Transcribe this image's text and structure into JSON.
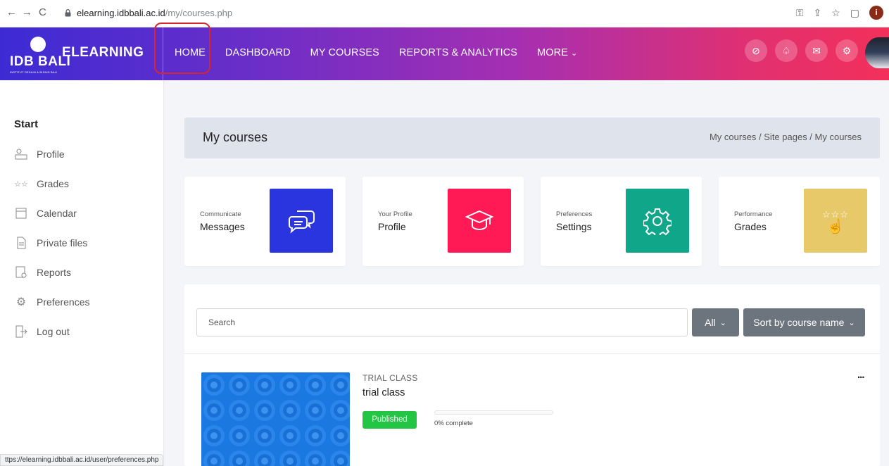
{
  "browser": {
    "url_host": "elearning.idbbali.ac.id",
    "url_path": "/my/courses.php",
    "status_url": "ttps://elearning.idbbali.ac.id/user/preferences.php",
    "profile_initial": "i"
  },
  "brand": {
    "logo_text": "IDB BALI",
    "logo_sub": "INSTITUT DESAIN & BISNIS BALI",
    "app_name": "ELEARNING"
  },
  "menu": {
    "home": "HOME",
    "dashboard": "DASHBOARD",
    "my_courses": "MY COURSES",
    "reports": "REPORTS & ANALYTICS",
    "more": "MORE"
  },
  "sidebar": {
    "start": "Start",
    "items": [
      {
        "label": "Profile",
        "icon": "profile-icon"
      },
      {
        "label": "Grades",
        "icon": "grades-icon"
      },
      {
        "label": "Calendar",
        "icon": "calendar-icon"
      },
      {
        "label": "Private files",
        "icon": "file-icon"
      },
      {
        "label": "Reports",
        "icon": "reports-icon"
      },
      {
        "label": "Preferences",
        "icon": "gear-icon"
      },
      {
        "label": "Log out",
        "icon": "logout-icon"
      }
    ]
  },
  "page": {
    "title": "My courses",
    "breadcrumb": "My courses / Site pages / My courses"
  },
  "cards": [
    {
      "sub": "Communicate",
      "main": "Messages",
      "color": "#2a35e0",
      "icon": "chat-icon"
    },
    {
      "sub": "Your Profile",
      "main": "Profile",
      "color": "#ff1a55",
      "icon": "graduation-cap-icon"
    },
    {
      "sub": "Preferences",
      "main": "Settings",
      "color": "#10a68a",
      "icon": "gear-icon"
    },
    {
      "sub": "Performance",
      "main": "Grades",
      "color": "#e7c96a",
      "icon": "stars-hand-icon"
    }
  ],
  "filters": {
    "search_placeholder": "Search",
    "all_label": "All",
    "sort_label": "Sort by course name"
  },
  "course": {
    "category": "TRIAL CLASS",
    "name": "trial class",
    "status": "Published",
    "progress_percent": 0,
    "progress_prefix": "0%",
    "progress_text": " complete",
    "more_label": "..."
  },
  "colors": {
    "accent_start": "#3c2bd4",
    "accent_end": "#f2305a",
    "published": "#23c644",
    "course_image": "#1a78e0"
  }
}
